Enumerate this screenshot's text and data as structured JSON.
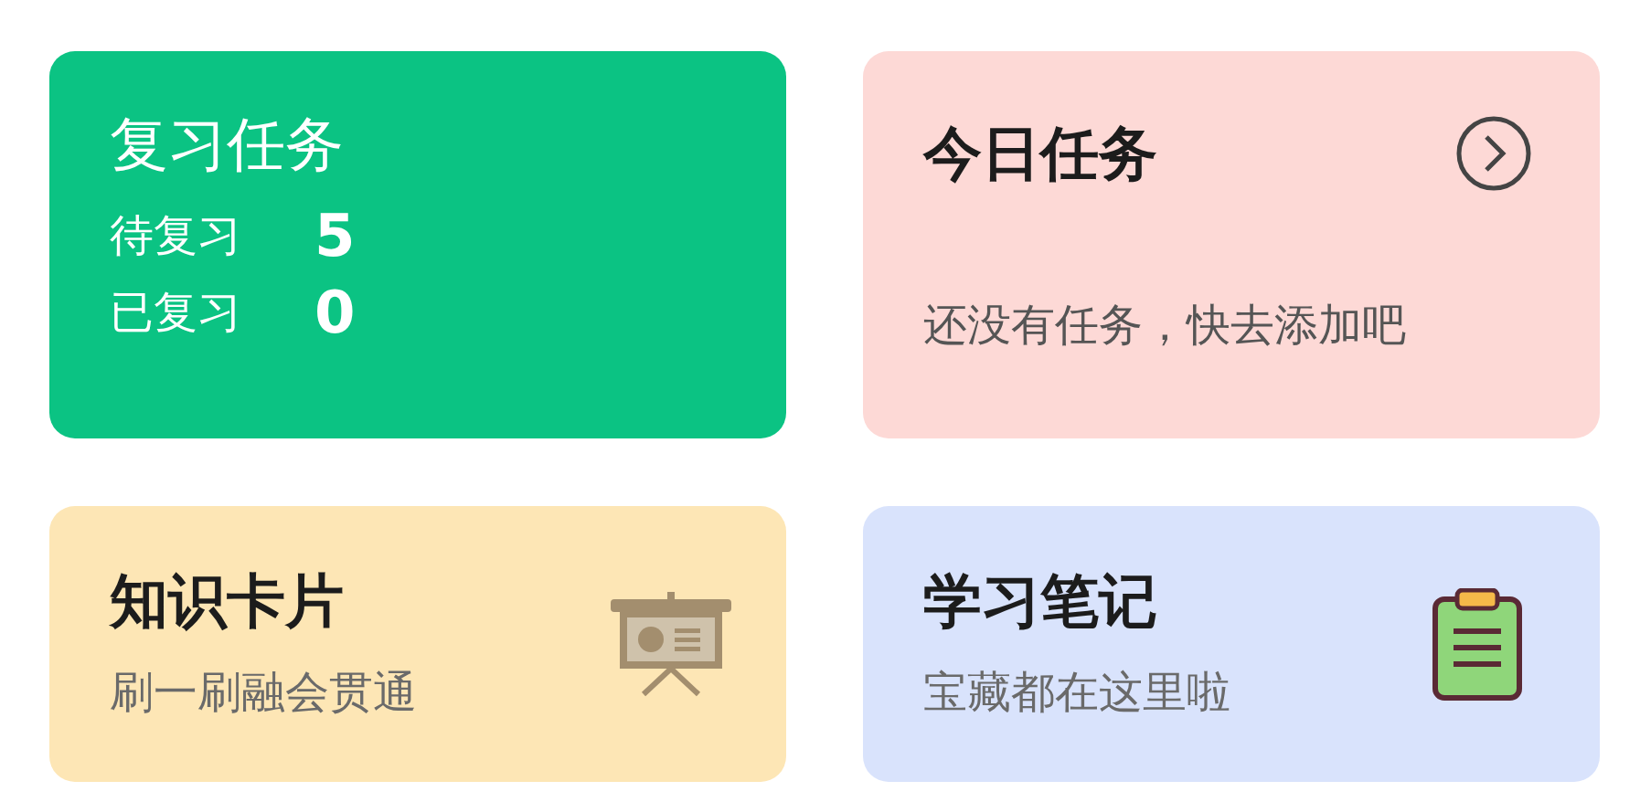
{
  "cards": [
    {
      "kind": "review",
      "title": "复习任务",
      "stats": [
        {
          "label": "待复习",
          "value": "5"
        },
        {
          "label": "已复习",
          "value": "0"
        }
      ]
    },
    {
      "kind": "today",
      "title": "今日任务",
      "message": "还没有任务，快去添加吧"
    },
    {
      "kind": "flashcards",
      "title": "知识卡片",
      "subtitle": "刷一刷融会贯通"
    },
    {
      "kind": "notes",
      "title": "学习笔记",
      "subtitle": "宝藏都在这里啦"
    }
  ]
}
